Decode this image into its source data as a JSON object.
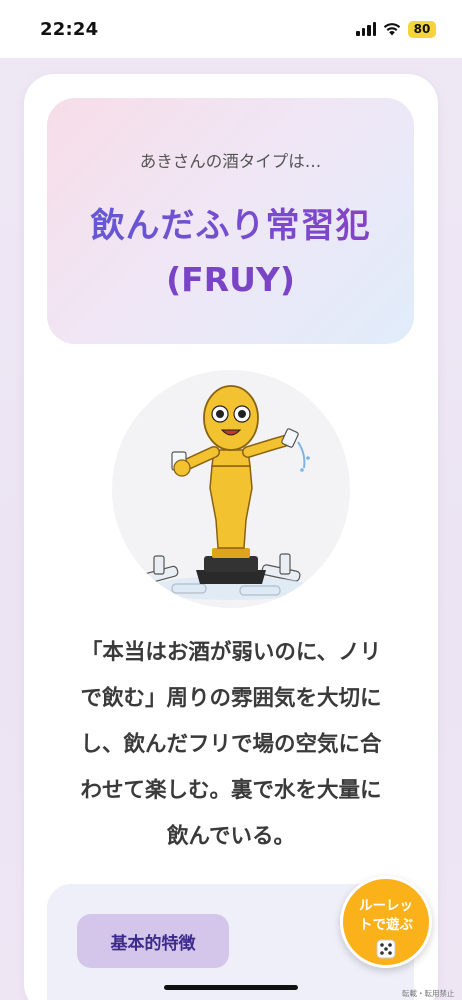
{
  "status": {
    "time": "22:24",
    "battery": "80"
  },
  "result": {
    "intro": "あきさんの酒タイプは…",
    "name": "飲んだふり常習犯",
    "code": "(FRUY)",
    "name_gradient": [
      "#5f5cd8",
      "#8a3fc4"
    ]
  },
  "description": [
    "「本当はお酒が弱いのに、ノリ",
    "で飲む」周りの雰囲気を大切に",
    "し、飲んだフリで場の空気に合",
    "わせて楽しむ。裏で水を大量に",
    "飲んでいる。"
  ],
  "features": {
    "heading": "基本的特徴"
  },
  "roulette": {
    "line1": "ルーレッ",
    "line2": "トで遊ぶ",
    "icon": "dice-icon"
  },
  "footer": {
    "copyright": "転載・転用禁止"
  },
  "colors": {
    "accent": "#6a48d0",
    "roulette": "#fbb21a",
    "chip": "#d4c5ea"
  }
}
